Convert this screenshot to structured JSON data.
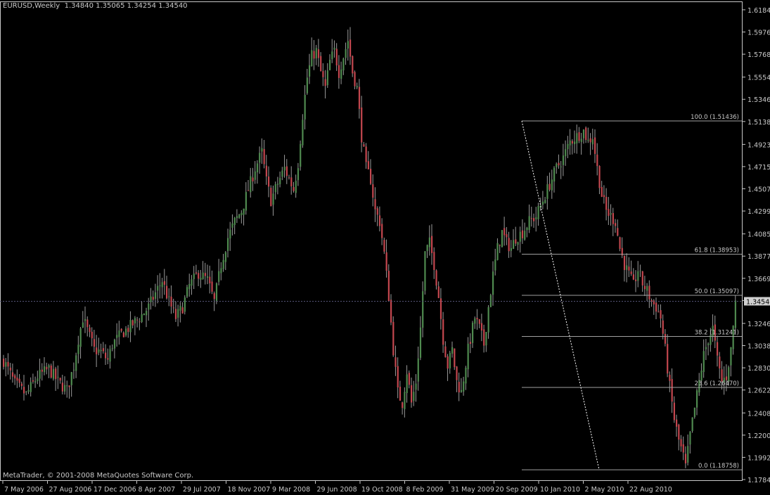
{
  "header": {
    "symbol": "EURUSD,Weekly",
    "ohlc": "1.34840 1.35065 1.34254 1.34540"
  },
  "copyright": "MetaTrader, © 2001-2008 MetaQuotes Software Corp.",
  "colors": {
    "background": "#000000",
    "bull": "#4f8a4f",
    "bear": "#c4474f",
    "wick": "#9a9a9a",
    "axis": "#c8c8c8",
    "fib_line": "#a0a0a0",
    "price_label_bg": "#d0d0d0"
  },
  "chart_data": {
    "type": "candlestick",
    "title": "EURUSD,Weekly",
    "ylim": [
      1.1784,
      1.6184
    ],
    "y_ticks": [
      "1.61845",
      "1.59765",
      "1.57685",
      "1.55540",
      "1.53460",
      "1.51380",
      "1.49235",
      "1.47155",
      "1.45075",
      "1.42995",
      "1.40850",
      "1.38770",
      "1.36690",
      "1.34610",
      "1.32465",
      "1.30385",
      "1.28305",
      "1.26225",
      "1.24080",
      "1.22000",
      "1.19920",
      "1.17840"
    ],
    "x_ticks": [
      "7 May 2006",
      "27 Aug 2006",
      "17 Dec 2006",
      "8 Apr 2007",
      "29 Jul 2007",
      "18 Nov 2007",
      "9 Mar 2008",
      "29 Jun 2008",
      "19 Oct 2008",
      "8 Feb 2009",
      "31 May 2009",
      "20 Sep 2009",
      "10 Jan 2010",
      "2 May 2010",
      "22 Aug 2010"
    ],
    "current_price": "1.34540",
    "close_path": [
      [
        0,
        1.29
      ],
      [
        5,
        1.268
      ],
      [
        10,
        1.258
      ],
      [
        15,
        1.275
      ],
      [
        20,
        1.282
      ],
      [
        24,
        1.27
      ],
      [
        28,
        1.262
      ],
      [
        31,
        1.285
      ],
      [
        33,
        1.31
      ],
      [
        35,
        1.33
      ],
      [
        37,
        1.318
      ],
      [
        40,
        1.3
      ],
      [
        43,
        1.298
      ],
      [
        46,
        1.29
      ],
      [
        48,
        1.305
      ],
      [
        52,
        1.315
      ],
      [
        56,
        1.322
      ],
      [
        60,
        1.33
      ],
      [
        64,
        1.34
      ],
      [
        67,
        1.353
      ],
      [
        70,
        1.365
      ],
      [
        73,
        1.345
      ],
      [
        76,
        1.33
      ],
      [
        79,
        1.34
      ],
      [
        82,
        1.36
      ],
      [
        86,
        1.372
      ],
      [
        90,
        1.365
      ],
      [
        93,
        1.345
      ],
      [
        96,
        1.38
      ],
      [
        99,
        1.405
      ],
      [
        102,
        1.42
      ],
      [
        105,
        1.43
      ],
      [
        108,
        1.45
      ],
      [
        111,
        1.47
      ],
      [
        114,
        1.485
      ],
      [
        116,
        1.458
      ],
      [
        118,
        1.44
      ],
      [
        121,
        1.456
      ],
      [
        124,
        1.47
      ],
      [
        126,
        1.46
      ],
      [
        128,
        1.45
      ],
      [
        130,
        1.475
      ],
      [
        132,
        1.52
      ],
      [
        134,
        1.555
      ],
      [
        136,
        1.575
      ],
      [
        138,
        1.58
      ],
      [
        140,
        1.56
      ],
      [
        142,
        1.545
      ],
      [
        144,
        1.57
      ],
      [
        146,
        1.58
      ],
      [
        148,
        1.56
      ],
      [
        150,
        1.575
      ],
      [
        152,
        1.59
      ],
      [
        154,
        1.56
      ],
      [
        156,
        1.545
      ],
      [
        158,
        1.5
      ],
      [
        160,
        1.47
      ],
      [
        162,
        1.46
      ],
      [
        164,
        1.43
      ],
      [
        166,
        1.42
      ],
      [
        168,
        1.39
      ],
      [
        170,
        1.35
      ],
      [
        172,
        1.3
      ],
      [
        174,
        1.26
      ],
      [
        176,
        1.25
      ],
      [
        178,
        1.28
      ],
      [
        180,
        1.25
      ],
      [
        182,
        1.27
      ],
      [
        184,
        1.32
      ],
      [
        186,
        1.39
      ],
      [
        188,
        1.4
      ],
      [
        190,
        1.38
      ],
      [
        192,
        1.35
      ],
      [
        194,
        1.31
      ],
      [
        196,
        1.285
      ],
      [
        198,
        1.3
      ],
      [
        200,
        1.27
      ],
      [
        202,
        1.26
      ],
      [
        205,
        1.3
      ],
      [
        208,
        1.33
      ],
      [
        210,
        1.32
      ],
      [
        212,
        1.305
      ],
      [
        214,
        1.34
      ],
      [
        216,
        1.37
      ],
      [
        218,
        1.395
      ],
      [
        220,
        1.41
      ],
      [
        222,
        1.4
      ],
      [
        224,
        1.395
      ],
      [
        226,
        1.405
      ],
      [
        229,
        1.41
      ],
      [
        232,
        1.42
      ],
      [
        235,
        1.425
      ],
      [
        238,
        1.44
      ],
      [
        241,
        1.455
      ],
      [
        244,
        1.47
      ],
      [
        247,
        1.48
      ],
      [
        250,
        1.495
      ],
      [
        253,
        1.5
      ],
      [
        256,
        1.505
      ],
      [
        258,
        1.495
      ],
      [
        260,
        1.5
      ],
      [
        262,
        1.47
      ],
      [
        264,
        1.445
      ],
      [
        266,
        1.43
      ],
      [
        268,
        1.425
      ],
      [
        270,
        1.42
      ],
      [
        272,
        1.395
      ],
      [
        274,
        1.38
      ],
      [
        276,
        1.37
      ],
      [
        278,
        1.36
      ],
      [
        280,
        1.375
      ],
      [
        282,
        1.362
      ],
      [
        284,
        1.355
      ],
      [
        286,
        1.345
      ],
      [
        288,
        1.34
      ],
      [
        290,
        1.33
      ],
      [
        292,
        1.3
      ],
      [
        294,
        1.265
      ],
      [
        296,
        1.235
      ],
      [
        298,
        1.215
      ],
      [
        300,
        1.2
      ],
      [
        301,
        1.19
      ],
      [
        303,
        1.22
      ],
      [
        305,
        1.245
      ],
      [
        307,
        1.27
      ],
      [
        309,
        1.295
      ],
      [
        311,
        1.31
      ],
      [
        313,
        1.32
      ],
      [
        315,
        1.29
      ],
      [
        317,
        1.27
      ],
      [
        319,
        1.275
      ],
      [
        321,
        1.3
      ],
      [
        323,
        1.345
      ]
    ],
    "fibonacci": {
      "high": 1.51436,
      "low": 1.18758,
      "levels": [
        {
          "label": "100.0 (1.51436)",
          "value": 1.51436
        },
        {
          "label": "61.8 (1.38953)",
          "value": 1.38953
        },
        {
          "label": "50.0 (1.35097)",
          "value": 1.35097
        },
        {
          "label": "38.2 (1.31241)",
          "value": 1.31241
        },
        {
          "label": "23.6 (1.26470)",
          "value": 1.2647
        },
        {
          "label": "0.0 (1.18758)",
          "value": 1.18758
        }
      ]
    }
  }
}
